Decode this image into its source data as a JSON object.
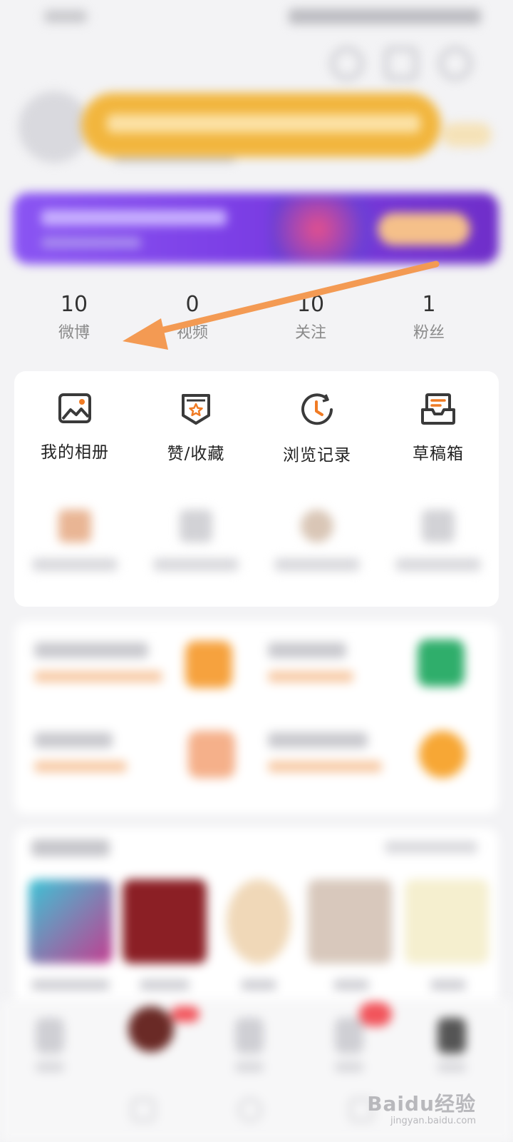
{
  "stats": [
    {
      "value": "10",
      "label": "微博"
    },
    {
      "value": "0",
      "label": "视频"
    },
    {
      "value": "10",
      "label": "关注"
    },
    {
      "value": "1",
      "label": "粉丝"
    }
  ],
  "grid_row1": [
    {
      "label": "我的相册",
      "icon": "album-icon"
    },
    {
      "label": "赞/收藏",
      "icon": "favorite-icon"
    },
    {
      "label": "浏览记录",
      "icon": "history-icon"
    },
    {
      "label": "草稿箱",
      "icon": "drafts-icon"
    }
  ],
  "accent_color": "#f07b24",
  "watermark": {
    "logo": "Baidu经验",
    "url": "jingyan.baidu.com"
  }
}
